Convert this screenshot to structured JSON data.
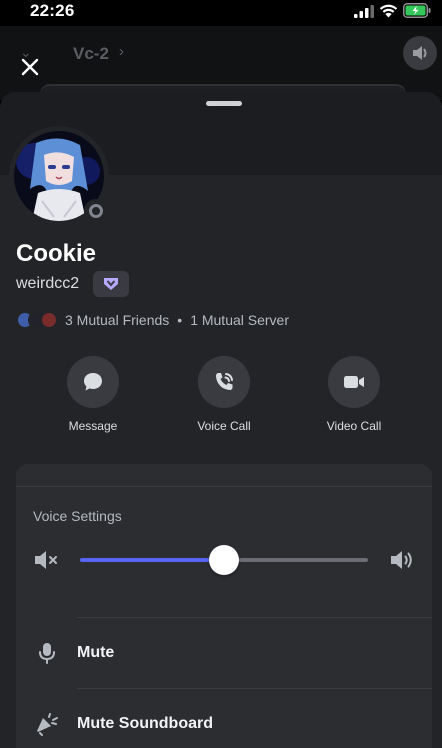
{
  "status_bar": {
    "time": "22:26"
  },
  "background_channel": {
    "title": "Vc-2",
    "arrow": "›"
  },
  "profile": {
    "display_name": "Cookie",
    "username": "weirdcc2",
    "mutual_friends": "3 Mutual Friends",
    "separator": "•",
    "mutual_servers": "1 Mutual Server",
    "status": "offline"
  },
  "actions": [
    {
      "label": "Message",
      "icon": "chat-bubble-icon"
    },
    {
      "label": "Voice Call",
      "icon": "phone-call-icon"
    },
    {
      "label": "Video Call",
      "icon": "video-camera-icon"
    }
  ],
  "voice_settings": {
    "title": "Voice Settings",
    "volume": 0.5,
    "rows": [
      {
        "label": "Mute",
        "icon": "microphone-icon"
      },
      {
        "label": "Mute Soundboard",
        "icon": "soundboard-icon"
      }
    ]
  },
  "colors": {
    "accent": "#5865f2",
    "sheet_bg": "#232428",
    "card_bg": "#2b2d31",
    "button_bg": "#3a3b41",
    "battery": "#34c759"
  }
}
